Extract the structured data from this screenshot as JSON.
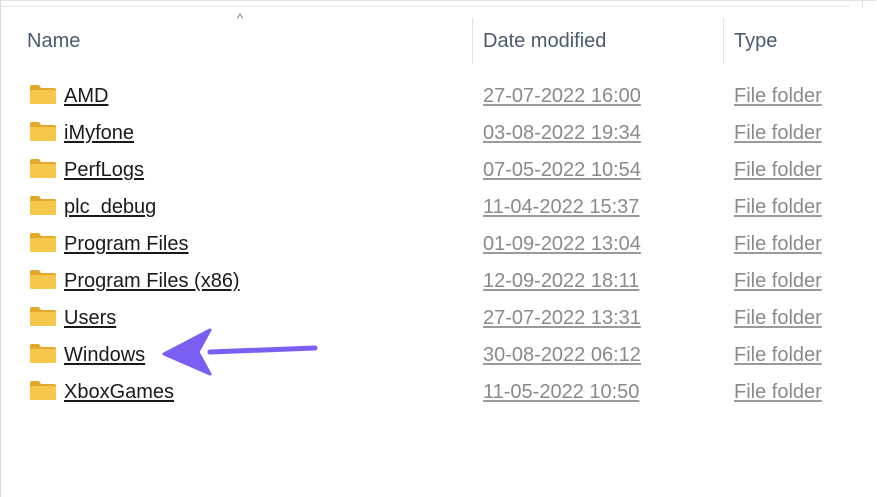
{
  "header": {
    "name_label": "Name",
    "date_label": "Date modified",
    "type_label": "Type",
    "sort_glyph": "^"
  },
  "rows": [
    {
      "name": "AMD",
      "date": "27-07-2022 16:00",
      "type": "File folder"
    },
    {
      "name": "iMyfone",
      "date": "03-08-2022 19:34",
      "type": "File folder"
    },
    {
      "name": "PerfLogs",
      "date": "07-05-2022 10:54",
      "type": "File folder"
    },
    {
      "name": "plc_debug",
      "date": "11-04-2022 15:37",
      "type": "File folder"
    },
    {
      "name": "Program Files",
      "date": "01-09-2022 13:04",
      "type": "File folder"
    },
    {
      "name": "Program Files (x86)",
      "date": "12-09-2022 18:11",
      "type": "File folder"
    },
    {
      "name": "Users",
      "date": "27-07-2022 13:31",
      "type": "File folder"
    },
    {
      "name": "Windows",
      "date": "30-08-2022 06:12",
      "type": "File folder"
    },
    {
      "name": "XboxGames",
      "date": "11-05-2022 10:50",
      "type": "File folder"
    }
  ],
  "colors": {
    "folder": "#f5c84c",
    "folder_dark": "#e4a92a",
    "arrow": "#7b5ef2"
  },
  "annotation": {
    "icon": "arrow-left-icon",
    "points_to": "Windows"
  }
}
